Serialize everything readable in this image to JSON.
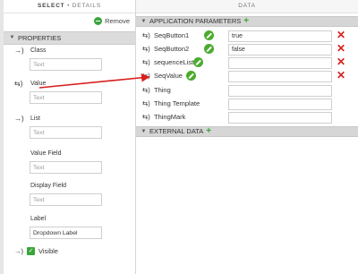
{
  "left_panel": {
    "header": {
      "select": "SELECT",
      "sep": " • ",
      "details": "DETAILS"
    },
    "remove_label": "Remove",
    "section_title": "PROPERTIES",
    "properties": [
      {
        "label": "Class",
        "placeholder": "Text",
        "icon": "→)"
      },
      {
        "label": "Value",
        "placeholder": "Text",
        "icon": "⇆)"
      },
      {
        "label": "List",
        "placeholder": "Text",
        "icon": "→)"
      },
      {
        "label": "Value Field",
        "placeholder": "Text",
        "icon": ""
      },
      {
        "label": "Display Field",
        "placeholder": "Text",
        "icon": ""
      },
      {
        "label": "Label",
        "value": "Dropdown Label",
        "icon": ""
      }
    ],
    "visible_label": "Visible"
  },
  "right_panel": {
    "header": "DATA",
    "sections": [
      {
        "title": "APPLICATION PARAMETERS"
      },
      {
        "title": "EXTERNAL DATA"
      }
    ],
    "params": [
      {
        "name": "SeqButton1",
        "value": "true",
        "editable": true,
        "deletable": true
      },
      {
        "name": "SeqButton2",
        "value": "false",
        "editable": true,
        "deletable": true
      },
      {
        "name": "sequenceList",
        "value": "",
        "editable": true,
        "deletable": true
      },
      {
        "name": "SeqValue",
        "value": "",
        "editable": true,
        "deletable": true
      },
      {
        "name": "Thing",
        "value": "",
        "editable": false,
        "deletable": false
      },
      {
        "name": "Thing Template",
        "value": "",
        "editable": false,
        "deletable": false
      },
      {
        "name": "ThingMark",
        "value": "",
        "editable": false,
        "deletable": false
      }
    ],
    "param_icon": "⇆)"
  },
  "colors": {
    "accent_green": "#3aa53a",
    "delete_red": "#d42020",
    "arrow_red": "#d81e1e"
  }
}
